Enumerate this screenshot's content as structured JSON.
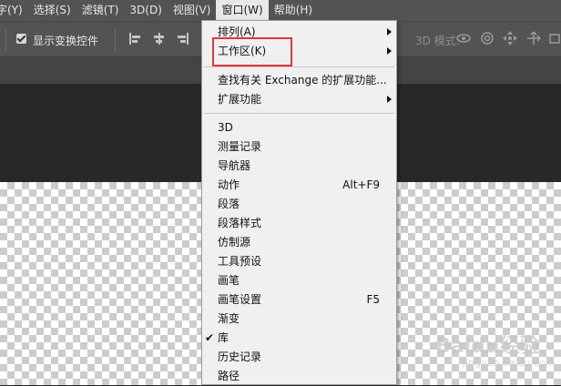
{
  "menubar": {
    "items": [
      "字(Y)",
      "选择(S)",
      "滤镜(T)",
      "3D(D)",
      "视图(V)",
      "窗口(W)",
      "帮助(H)"
    ],
    "active_index": 5
  },
  "options": {
    "checkbox_label": "显示变换控件",
    "checkbox_checked": true,
    "mode_label": "3D 模式:"
  },
  "window_menu": {
    "items": [
      {
        "label": "排列(A)",
        "submenu": true
      },
      {
        "label": "工作区(K)",
        "submenu": true,
        "highlighted": true
      },
      {
        "label": "查找有关 Exchange 的扩展功能...",
        "submenu": false
      },
      {
        "label": "扩展功能",
        "submenu": true
      },
      {
        "label": "3D"
      },
      {
        "label": "测量记录"
      },
      {
        "label": "导航器"
      },
      {
        "label": "动作",
        "shortcut": "Alt+F9"
      },
      {
        "label": "段落"
      },
      {
        "label": "段落样式"
      },
      {
        "label": "仿制源"
      },
      {
        "label": "工具预设"
      },
      {
        "label": "画笔"
      },
      {
        "label": "画笔设置",
        "shortcut": "F5"
      },
      {
        "label": "渐变"
      },
      {
        "label": "库",
        "checked": true
      },
      {
        "label": "历史记录"
      },
      {
        "label": "路径"
      }
    ]
  },
  "watermark": {
    "text": "Baidu经验",
    "sub": "jingyan.baidu.com"
  },
  "colors": {
    "highlight_box": "#e0363c",
    "menubar": "#535353",
    "menu_bg": "#f0f0f0"
  }
}
